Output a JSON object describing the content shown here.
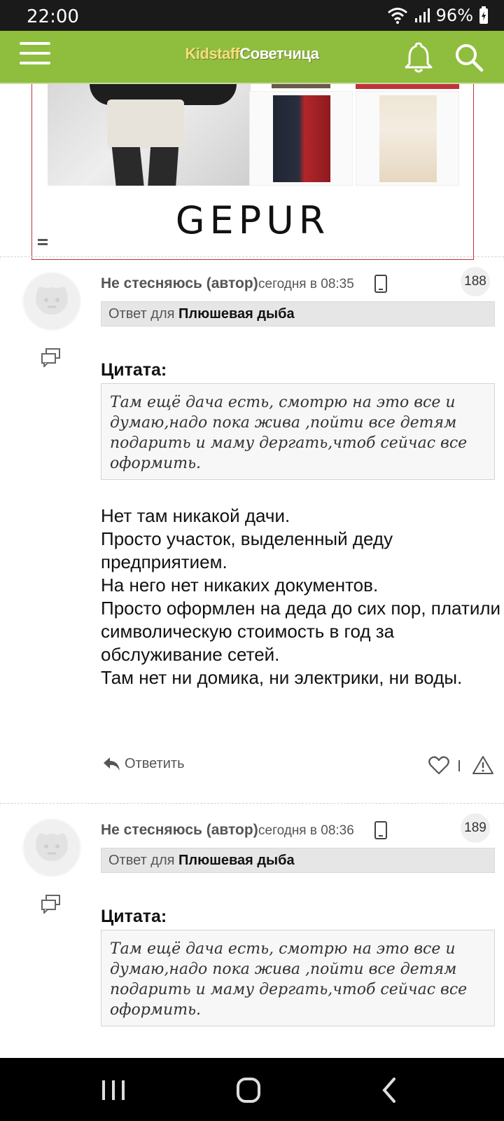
{
  "status_bar": {
    "time": "22:00",
    "battery": "96%"
  },
  "header": {
    "brand_part1": "Kidstaff",
    "brand_part2": "Советчица"
  },
  "ad": {
    "logo": "GEPUR"
  },
  "posts": [
    {
      "author": "Не стесняюсь (автор)",
      "time": "сегодня в 08:35",
      "number": "188",
      "reply_prefix": "Ответ для ",
      "reply_to": "Плюшевая дыба",
      "quote_title": "Цитата:",
      "quote_text": "Там ещё дача есть, смотрю на это все и думаю,надо пока жива ,пойти все детям подарить и маму дергать,чтоб сейчас все оформить.",
      "body": "Нет там никакой дачи.\nПросто участок, выделенный деду предприятием.\nНа него нет никаких документов.\nПросто оформлен на деда до сих пор, платили символическую стоимость в год за обслуживание сетей.\nТам нет ни домика, ни электрики, ни воды.",
      "reply_label": "Ответить"
    },
    {
      "author": "Не стесняюсь (автор)",
      "time": "сегодня в 08:36",
      "number": "189",
      "reply_prefix": "Ответ для ",
      "reply_to": "Плюшевая дыба",
      "quote_title": "Цитата:",
      "quote_text": "Там ещё дача есть, смотрю на это все и думаю,надо пока жива ,пойти все детям подарить и маму дергать,чтоб сейчас все оформить."
    }
  ],
  "icons": {
    "menu": "hamburger-icon",
    "bell": "bell-icon",
    "search": "search-icon",
    "quote": "quote-icon",
    "reply": "reply-arrow-icon",
    "like": "heart-icon",
    "report": "warning-icon"
  },
  "colors": {
    "header_bg": "#8fbd3e",
    "brand_accent": "#f5df7a",
    "ad_border": "#c0333a"
  }
}
